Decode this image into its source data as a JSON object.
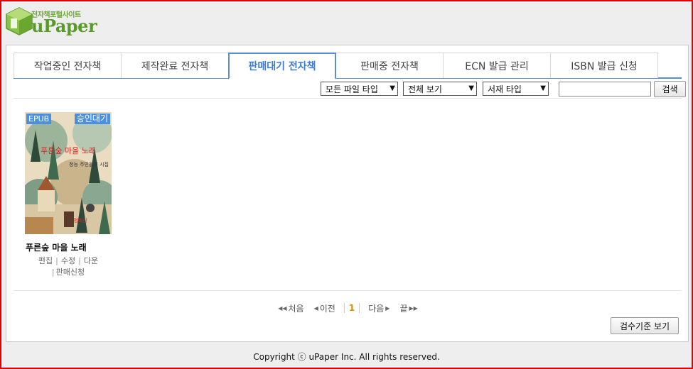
{
  "logo": {
    "tagline": "전자책포털사이트",
    "wordmark": "uPaper"
  },
  "tabs": [
    {
      "label": "작업중인 전자책",
      "active": false
    },
    {
      "label": "제작완료 전자책",
      "active": false
    },
    {
      "label": "판매대기 전자책",
      "active": true
    },
    {
      "label": "판매중 전자책",
      "active": false
    },
    {
      "label": "ECN 발급 관리",
      "active": false
    },
    {
      "label": "ISBN 발급 신청",
      "active": false
    }
  ],
  "filters": {
    "file_type": "모든 파일 타입",
    "view": "전체 보기",
    "book_type": "서재 타입",
    "search_value": "",
    "search_button": "검색"
  },
  "book": {
    "format_badge": "EPUB",
    "status_badge": "승인대기",
    "title": "푸른숲 마을 노래",
    "actions": [
      "편집",
      "수정",
      "다운",
      "판매신청"
    ]
  },
  "pager": {
    "first": "처음",
    "prev": "이전",
    "current": "1",
    "next": "다음",
    "last": "끝"
  },
  "review_button": "검수기준 보기",
  "footer": "Copyright ⓒ uPaper Inc. All rights reserved."
}
